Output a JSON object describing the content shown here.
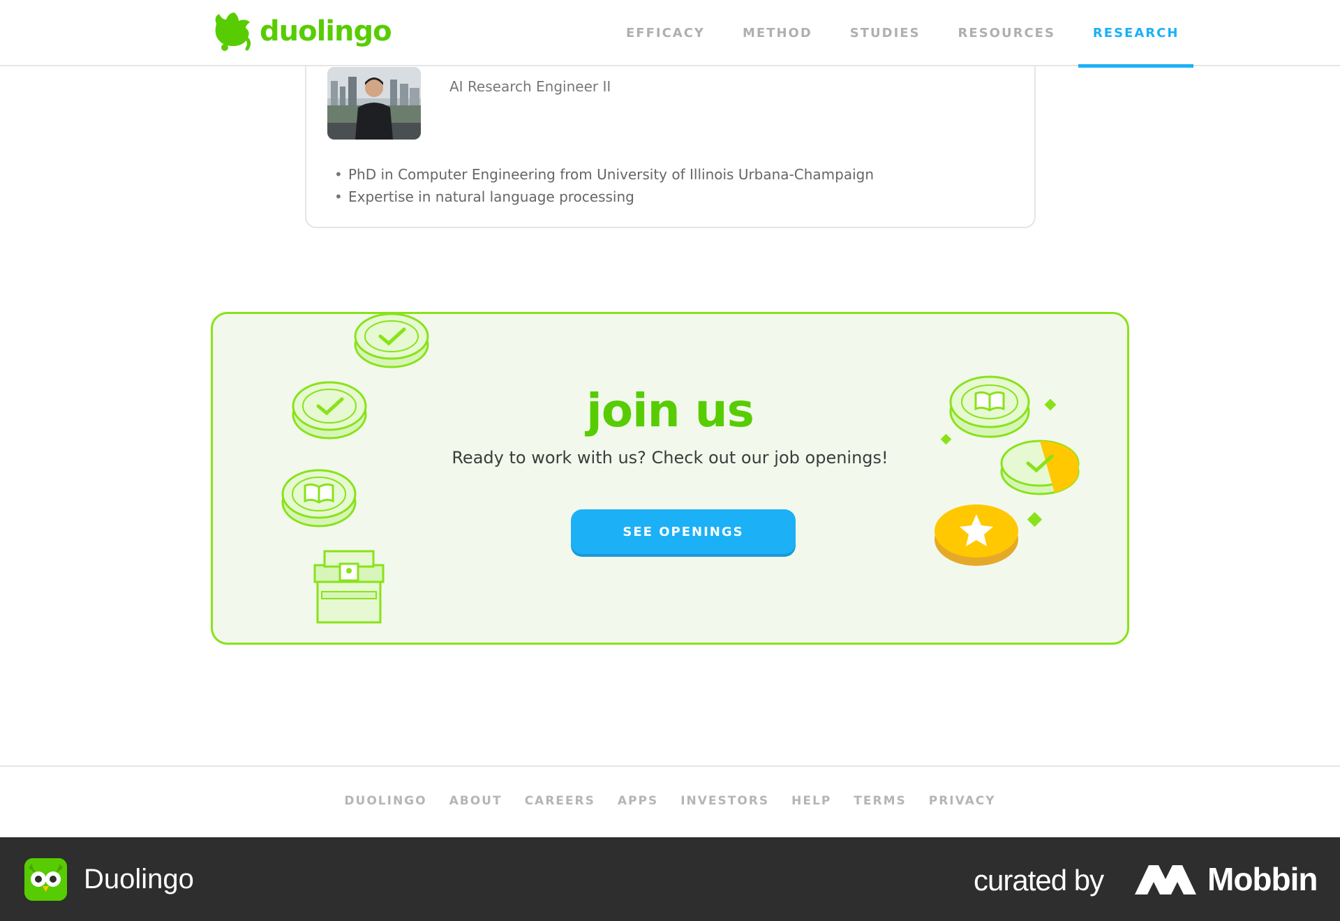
{
  "header": {
    "logo_text": "duolingo",
    "nav": [
      {
        "label": "EFFICACY"
      },
      {
        "label": "METHOD"
      },
      {
        "label": "STUDIES"
      },
      {
        "label": "RESOURCES"
      },
      {
        "label": "RESEARCH"
      }
    ],
    "active_nav": "RESEARCH"
  },
  "profile": {
    "role": "AI Research Engineer II",
    "bullets": [
      "PhD in Computer Engineering from University of Illinois Urbana-Champaign",
      "Expertise in natural language processing"
    ]
  },
  "join": {
    "title": "join us",
    "text": "Ready to work with us? Check out our job openings!",
    "button_label": "SEE OPENINGS"
  },
  "footer": {
    "links": [
      "DUOLINGO",
      "ABOUT",
      "CAREERS",
      "APPS",
      "INVESTORS",
      "HELP",
      "TERMS",
      "PRIVACY"
    ]
  },
  "brand_bar": {
    "app_name": "Duolingo",
    "curated_by": "curated by",
    "curator": "Mobbin"
  },
  "colors": {
    "brand_green": "#58cc02",
    "accent_blue": "#1cb0f6",
    "panel_border": "#89e219",
    "panel_bg": "#f2f9ec",
    "bar_bg": "#2e2e2e"
  },
  "icons": [
    "duo-logo-icon",
    "chest-icon",
    "coin-check-icon",
    "coin-book-icon",
    "star-coin-icon",
    "duo-owl-icon",
    "mobbin-logo-icon"
  ]
}
